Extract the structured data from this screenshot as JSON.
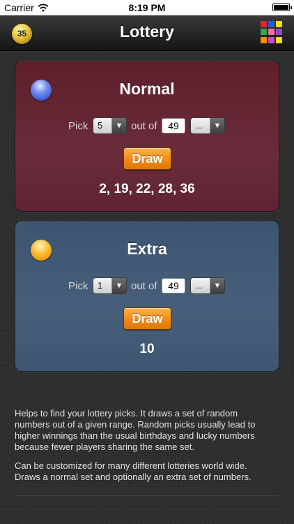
{
  "status_bar": {
    "carrier": "Carrier",
    "time": "8:19 PM"
  },
  "nav": {
    "title": "Lottery",
    "badge_number": "35"
  },
  "grid_icon_colors": [
    "#e8212c",
    "#1f5fe0",
    "#ffdf00",
    "#31a84d",
    "#ff6ea0",
    "#8f49c9",
    "#ff8c00",
    "#c44dc4",
    "#f7e01a"
  ],
  "normal": {
    "title": "Normal",
    "pick_label": "Pick",
    "pick_count": "5",
    "out_of_label": "out of",
    "range_max": "49",
    "range_option": "...",
    "draw_label": "Draw",
    "result": "2, 19, 22, 28, 36"
  },
  "extra": {
    "title": "Extra",
    "pick_label": "Pick",
    "pick_count": "1",
    "out_of_label": "out of",
    "range_max": "49",
    "range_option": "...",
    "draw_label": "Draw",
    "result": "10"
  },
  "description": [
    "Helps to find your lottery picks. It draws a set of random numbers out of a given range. Random picks usually lead to higher winnings than the usual birthdays and lucky numbers because fewer players sharing the same set.",
    "Can be customized for many different lotteries world wide. Draws a normal set and optionally an extra set of numbers."
  ]
}
